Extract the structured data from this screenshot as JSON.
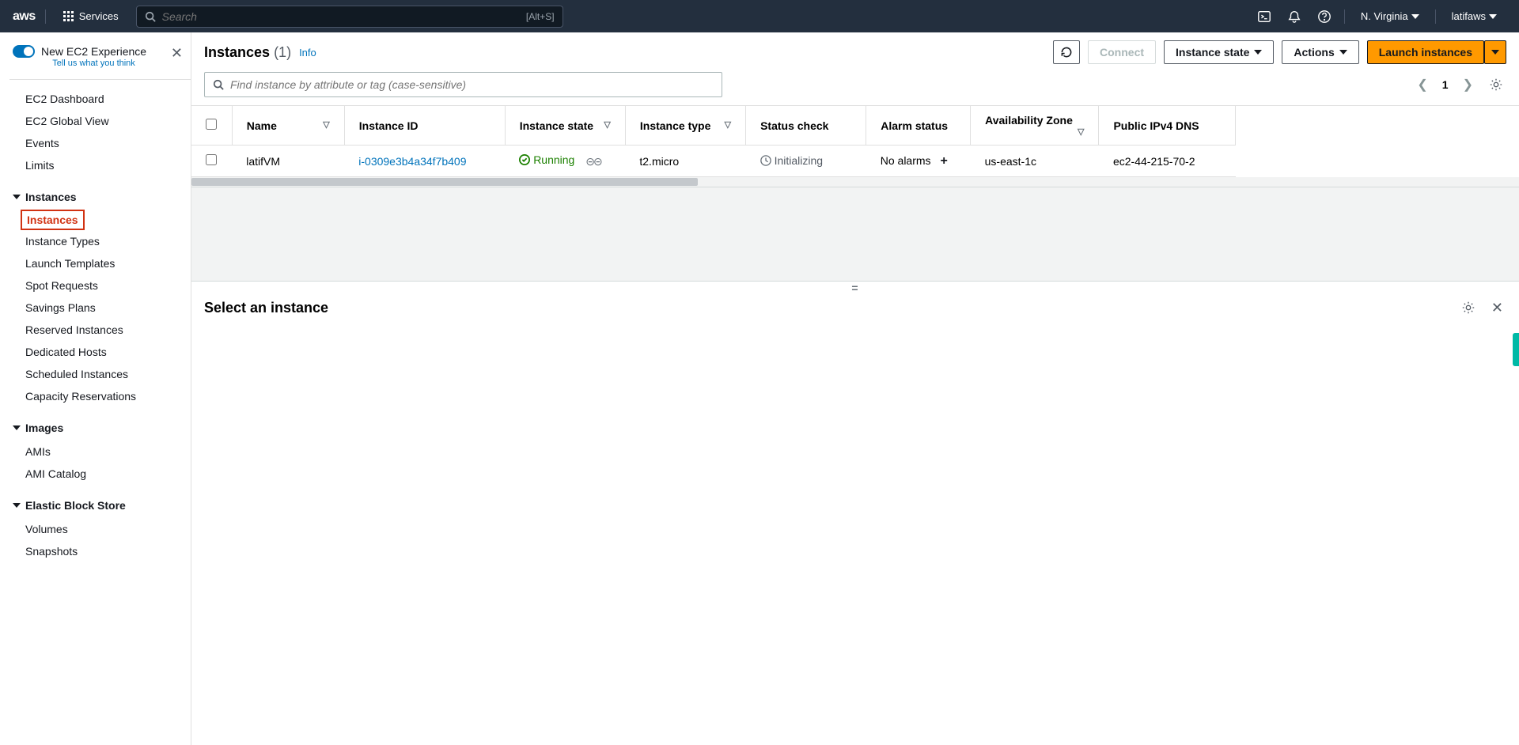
{
  "nav": {
    "services_label": "Services",
    "search_placeholder": "Search",
    "search_shortcut": "[Alt+S]",
    "region": "N. Virginia",
    "user": "latifaws"
  },
  "sidebar": {
    "new_experience_title": "New EC2 Experience",
    "new_experience_sub": "Tell us what you think",
    "links_top": [
      "EC2 Dashboard",
      "EC2 Global View",
      "Events",
      "Limits"
    ],
    "sections": [
      {
        "title": "Instances",
        "items": [
          "Instances",
          "Instance Types",
          "Launch Templates",
          "Spot Requests",
          "Savings Plans",
          "Reserved Instances",
          "Dedicated Hosts",
          "Scheduled Instances",
          "Capacity Reservations"
        ],
        "active_index": 0
      },
      {
        "title": "Images",
        "items": [
          "AMIs",
          "AMI Catalog"
        ]
      },
      {
        "title": "Elastic Block Store",
        "items": [
          "Volumes",
          "Snapshots"
        ]
      }
    ]
  },
  "main": {
    "title": "Instances",
    "count": "(1)",
    "info_label": "Info",
    "buttons": {
      "connect": "Connect",
      "instance_state": "Instance state",
      "actions": "Actions",
      "launch": "Launch instances"
    },
    "filter_placeholder": "Find instance by attribute or tag (case-sensitive)",
    "page": "1",
    "columns": [
      "Name",
      "Instance ID",
      "Instance state",
      "Instance type",
      "Status check",
      "Alarm status",
      "Availability Zone",
      "Public IPv4 DNS"
    ],
    "rows": [
      {
        "name": "latifVM",
        "instance_id": "i-0309e3b4a34f7b409",
        "state": "Running",
        "type": "t2.micro",
        "status": "Initializing",
        "alarm": "No alarms",
        "az": "us-east-1c",
        "dns": "ec2-44-215-70-2"
      }
    ],
    "detail_title": "Select an instance"
  }
}
